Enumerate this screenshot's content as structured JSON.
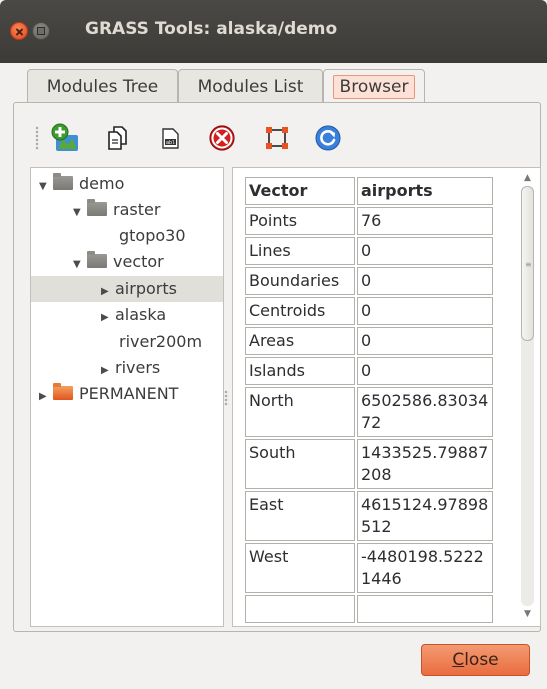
{
  "window": {
    "title": "GRASS Tools: alaska/demo",
    "close_icon": "close-icon",
    "minimize_icon": "minimize-icon"
  },
  "tabs": [
    {
      "label": "Modules Tree",
      "active": false
    },
    {
      "label": "Modules List",
      "active": false
    },
    {
      "label": "Browser",
      "active": true
    }
  ],
  "toolbar": {
    "icons": [
      "add-map-icon",
      "copy-icon",
      "rename-icon",
      "delete-icon",
      "set-region-icon",
      "refresh-icon"
    ]
  },
  "tree": {
    "items": [
      {
        "label": "demo",
        "depth": 0,
        "expanded": true,
        "type": "folder"
      },
      {
        "label": "raster",
        "depth": 1,
        "expanded": true,
        "type": "folder"
      },
      {
        "label": "gtopo30",
        "depth": 2,
        "type": "map"
      },
      {
        "label": "vector",
        "depth": 1,
        "expanded": true,
        "type": "folder"
      },
      {
        "label": "airports",
        "depth": 2,
        "type": "map",
        "selected": true,
        "collapsed": true
      },
      {
        "label": "alaska",
        "depth": 2,
        "type": "map",
        "collapsed": true
      },
      {
        "label": "river200m",
        "depth": 2,
        "type": "map"
      },
      {
        "label": "rivers",
        "depth": 2,
        "type": "map",
        "collapsed": true
      },
      {
        "label": "PERMANENT",
        "depth": 0,
        "expanded": false,
        "type": "mapset"
      }
    ]
  },
  "info_table": {
    "header": [
      "Vector",
      "airports"
    ],
    "rows": [
      [
        "Points",
        "76"
      ],
      [
        "Lines",
        "0"
      ],
      [
        "Boundaries",
        "0"
      ],
      [
        "Centroids",
        "0"
      ],
      [
        "Areas",
        "0"
      ],
      [
        "Islands",
        "0"
      ],
      [
        "North",
        "6502586.8303472"
      ],
      [
        "South",
        "1433525.79887208"
      ],
      [
        "East",
        "4615124.97898512"
      ],
      [
        "West",
        "-4480198.52221446"
      ],
      [
        "",
        ""
      ]
    ]
  },
  "close_button": {
    "label": "Close",
    "mnemonic": "C",
    "rest": "lose"
  },
  "colors": {
    "accent": "#e96d3f",
    "titlebar": "#3c3b37",
    "tab_active": "#fde1d6"
  }
}
